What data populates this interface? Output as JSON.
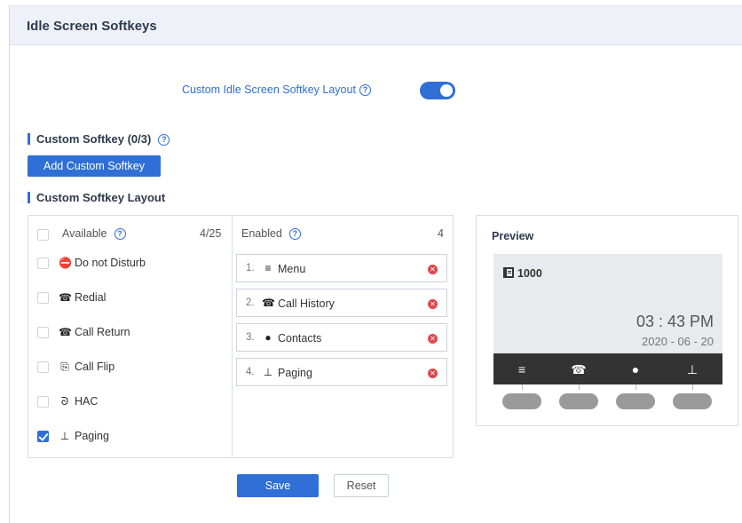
{
  "header": {
    "title": "Idle Screen Softkeys"
  },
  "toggle": {
    "label": "Custom Idle Screen Softkey Layout",
    "help": "?",
    "enabled": true
  },
  "custom_softkey": {
    "title": "Custom Softkey (0/3)",
    "help": "?",
    "add_button": "Add Custom Softkey"
  },
  "layout": {
    "title": "Custom Softkey Layout",
    "available": {
      "header": "Available",
      "help": "?",
      "count": "4/25",
      "items": [
        {
          "label": "Do not Disturb",
          "icon": "dnd-icon",
          "glyph": "⛔",
          "checked": false
        },
        {
          "label": "Redial",
          "icon": "redial-icon",
          "glyph": "☎",
          "checked": false
        },
        {
          "label": "Call Return",
          "icon": "call-return-icon",
          "glyph": "☎",
          "checked": false
        },
        {
          "label": "Call Flip",
          "icon": "call-flip-icon",
          "glyph": "⎘",
          "checked": false
        },
        {
          "label": "HAC",
          "icon": "hac-icon",
          "glyph": "ᘐ",
          "checked": false
        },
        {
          "label": "Paging",
          "icon": "paging-icon",
          "glyph": "⊥",
          "checked": true
        }
      ]
    },
    "enabled": {
      "header": "Enabled",
      "help": "?",
      "count": "4",
      "items": [
        {
          "num": "1.",
          "label": "Menu",
          "icon": "menu-icon",
          "glyph": "≡"
        },
        {
          "num": "2.",
          "label": "Call History",
          "icon": "call-history-icon",
          "glyph": "☎"
        },
        {
          "num": "3.",
          "label": "Contacts",
          "icon": "contacts-icon",
          "glyph": "●"
        },
        {
          "num": "4.",
          "label": "Paging",
          "icon": "paging-icon",
          "glyph": "⊥"
        }
      ]
    }
  },
  "preview": {
    "title": "Preview",
    "line": "1000",
    "time": "03 : 43 PM",
    "date": "2020 - 06 - 20",
    "softkeys": [
      "menu-icon",
      "call-history-icon",
      "contacts-icon",
      "paging-icon"
    ]
  },
  "actions": {
    "save": "Save",
    "reset": "Reset"
  },
  "colors": {
    "accent": "#2f6fd6",
    "header_bg": "#eef2f8",
    "remove": "#e0474c",
    "softkey_bar": "#333333"
  }
}
